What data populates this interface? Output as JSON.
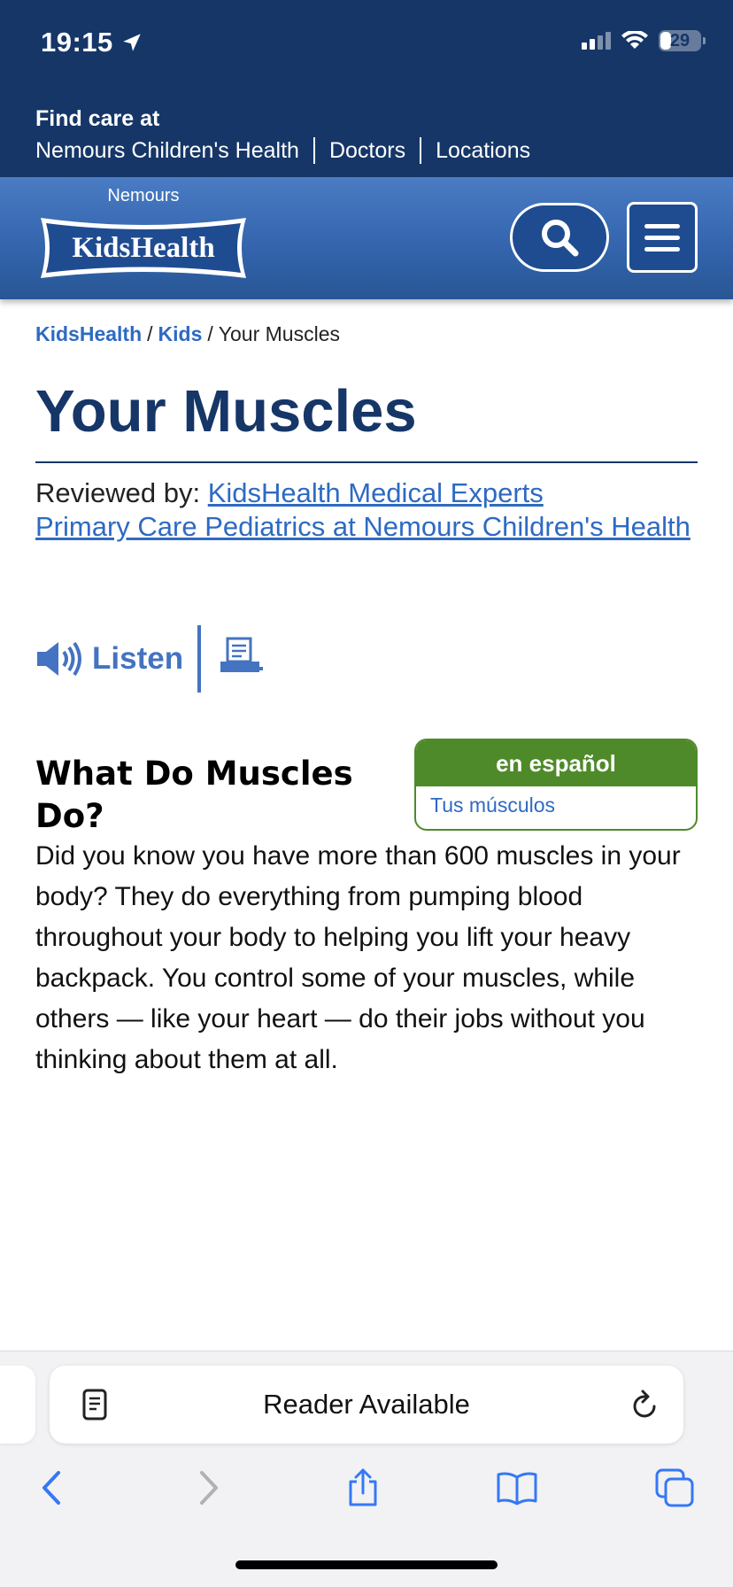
{
  "status_bar": {
    "time": "19:15",
    "battery": "29"
  },
  "find_care": {
    "title": "Find care at",
    "links": [
      "Nemours Children's Health",
      "Doctors",
      "Locations"
    ]
  },
  "header": {
    "logo_top": "Nemours",
    "logo_main": "KidsHealth"
  },
  "breadcrumb": {
    "items": [
      "KidsHealth",
      "Kids"
    ],
    "current": "Your Muscles",
    "separator": "/"
  },
  "page": {
    "title": "Your Muscles",
    "reviewed_prefix": "Reviewed by:",
    "reviewer_1": "KidsHealth Medical Experts",
    "reviewer_2": "Primary Care Pediatrics at Nemours Children's Health",
    "listen_label": "Listen",
    "espanol_heading": "en español",
    "espanol_link": "Tus músculos",
    "section_title": "What Do Muscles Do?",
    "body_text": "Did you know you have more than 600 muscles in your body? They do everything from pumping blood throughout your body to helping you lift your heavy backpack. You control some of your muscles, while others — like your heart — do their jobs without you thinking about them at all."
  },
  "safari": {
    "address_text": "Reader Available"
  },
  "colors": {
    "navy": "#163668",
    "link_blue": "#2e6ac2",
    "espanol_green": "#4f8a2a",
    "header_blue": "#3465ae"
  },
  "icons": [
    "location-arrow-icon",
    "signal-icon",
    "wifi-icon",
    "battery-icon",
    "search-icon",
    "menu-icon",
    "speaker-icon",
    "print-icon",
    "reader-icon",
    "reload-icon",
    "back-icon",
    "forward-icon",
    "share-icon",
    "bookmarks-icon",
    "tabs-icon"
  ]
}
